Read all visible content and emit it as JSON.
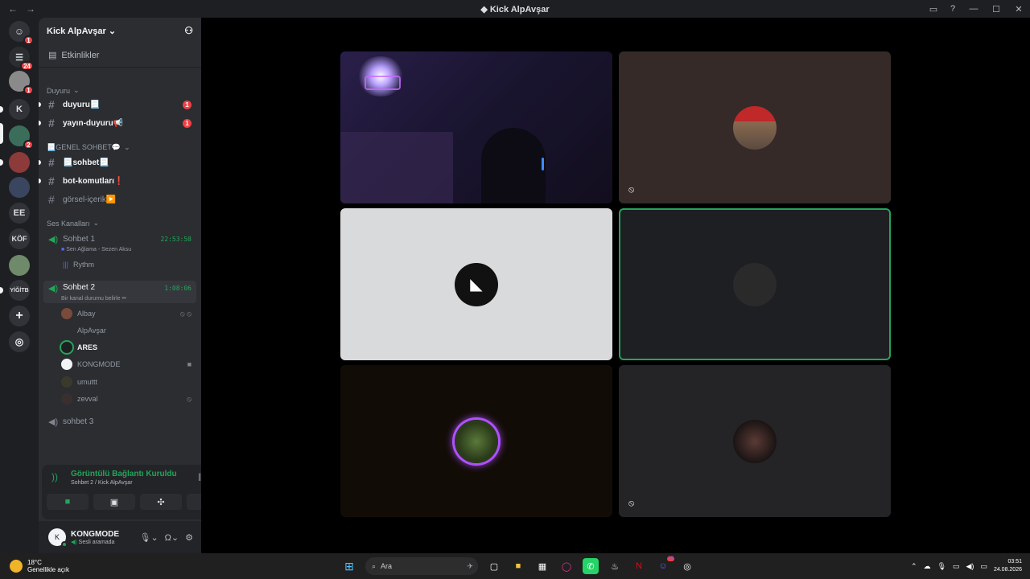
{
  "window": {
    "title": "Kick AlpAvşar",
    "back": "←",
    "forward": "→"
  },
  "servers": [
    {
      "label": "",
      "badge": "1"
    },
    {
      "label": "",
      "badge": "24"
    },
    {
      "label": "",
      "badge": "1"
    },
    {
      "label": "K",
      "badge": ""
    },
    {
      "label": "",
      "badge": "2"
    },
    {
      "label": "",
      "badge": ""
    },
    {
      "label": "",
      "badge": ""
    },
    {
      "label": "EE",
      "badge": ""
    },
    {
      "label": "KÖF",
      "badge": ""
    },
    {
      "label": "",
      "badge": ""
    },
    {
      "label": "YİĞİTB",
      "badge": ""
    }
  ],
  "guild": {
    "name": "Kick AlpAvşar",
    "events": "Etkinlikler"
  },
  "categories": {
    "duyuru": "Duyuru",
    "genel": "📃GENEL SOHBET💬",
    "ses": "Ses Kanalları"
  },
  "text_channels": [
    {
      "name": "duyuru📃",
      "mention": "1"
    },
    {
      "name": "yayın-duyuru📢",
      "mention": "1"
    },
    {
      "name": "📃sohbet📃",
      "mention": ""
    },
    {
      "name": "bot-komutları❗",
      "mention": ""
    },
    {
      "name": "görsel-içerik▶️",
      "mention": ""
    }
  ],
  "voice_channels": [
    {
      "name": "Sohbet 1",
      "time": "22:53:58",
      "status": "Sen Ağlama - Sezen Aksu",
      "member": "Rythm"
    },
    {
      "name": "Sohbet 2",
      "time": "1:08:06",
      "status": "Bir kanal durumu belirle ✏"
    },
    {
      "name": "sohbet 3"
    }
  ],
  "members": [
    "Albay",
    "AlpAvşar",
    "ARES",
    "KONGMODE",
    "umuttt",
    "zevval"
  ],
  "voice_panel": {
    "status": "Görüntülü Bağlantı Kuruldu",
    "sub": "Sohbet 2 / Kick AlpAvşar"
  },
  "user": {
    "name": "KONGMODE",
    "status": "Sesli aramada"
  },
  "taskbar": {
    "temp": "18°C",
    "weather": "Genellikle açık",
    "search": "Ara",
    "time": "03:51",
    "date": "24.08.2026",
    "discord_badge": "57"
  },
  "colors": {
    "green": "#23a55a",
    "red": "#f23f43",
    "bg": "#1e1f22",
    "sidebar": "#2b2d31"
  }
}
